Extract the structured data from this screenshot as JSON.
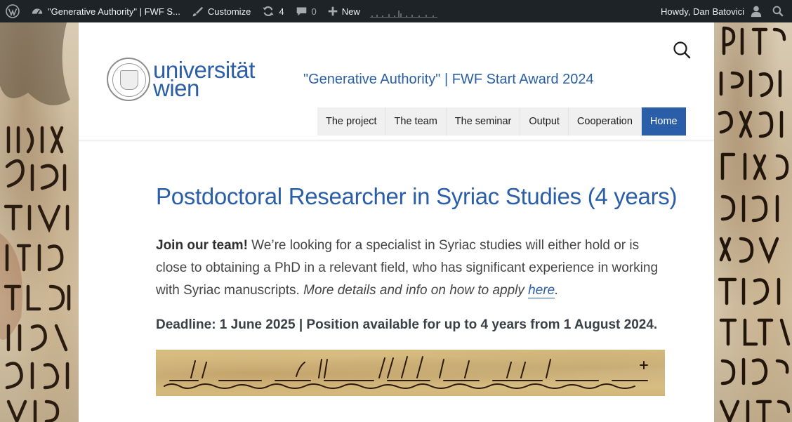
{
  "admin_bar": {
    "site_name": "\"Generative Authority\" | FWF S...",
    "customize": "Customize",
    "updates_count": "4",
    "comments_count": "0",
    "new_label": "New",
    "howdy": "Howdy, Dan Batovici"
  },
  "header": {
    "logo_line1": "universität",
    "logo_line2": "wien",
    "site_title": "\"Generative Authority\" | FWF Start Award 2024"
  },
  "nav": {
    "items": [
      "The project",
      "The team",
      "The seminar",
      "Output",
      "Cooperation",
      "Home"
    ],
    "active": "Home"
  },
  "content": {
    "title": "Postdoctoral Researcher in Syriac Studies (4 years)",
    "intro_bold": "Join our team!",
    "intro_text": " We’re looking for a specialist in Syriac studies will either hold or is close to obtaining a PhD in a relevant field, who has significant experience in working with Syriac manuscripts. ",
    "intro_italic": "More details and info on how to apply ",
    "intro_link": "here",
    "intro_end": ".",
    "deadline": "Deadline: 1 June 2025 | Position available for up to 4 years from 1 August 2024."
  },
  "colors": {
    "accent": "#2a5ea8",
    "admin_bar": "#1d2327"
  },
  "icons": {
    "wordpress": "wordpress-icon",
    "dashboard": "dashboard-icon",
    "customize": "brush-icon",
    "updates": "refresh-icon",
    "comments": "comment-icon",
    "new": "plus-icon",
    "user": "user-avatar-icon",
    "search": "search-icon"
  }
}
